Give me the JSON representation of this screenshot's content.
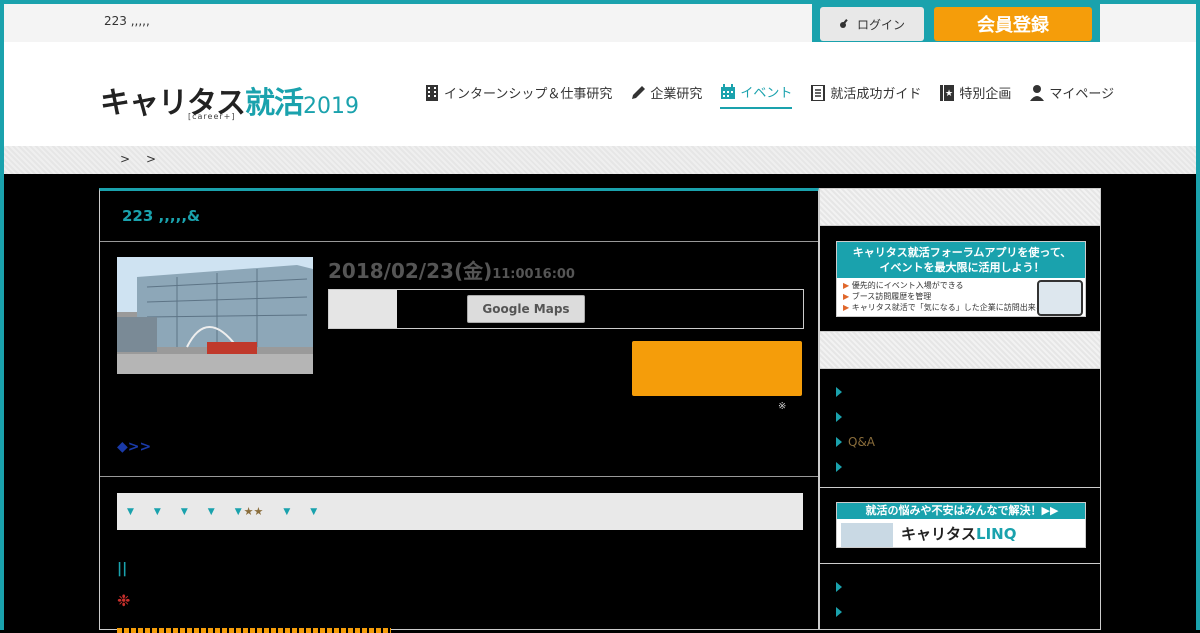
{
  "top": {
    "crumb": "223 ,,,,,",
    "login_label": "ログイン",
    "register_label": "会員登録"
  },
  "logo": {
    "main": "キャリタス",
    "accent": "就活",
    "year": "2019",
    "sub": "[career+]"
  },
  "nav": [
    {
      "label": "インターンシップ＆仕事研究",
      "icon": "building-icon"
    },
    {
      "label": "企業研究",
      "icon": "pencil-icon"
    },
    {
      "label": "イベント",
      "icon": "calendar-icon",
      "active": true
    },
    {
      "label": "就活成功ガイド",
      "icon": "document-icon"
    },
    {
      "label": "特別企画",
      "icon": "star-book-icon"
    },
    {
      "label": "マイページ",
      "icon": "user-icon"
    }
  ],
  "breadcrumb": {
    "sep1": ">",
    "sep2": ">"
  },
  "event": {
    "title": "223 ,,,,,&",
    "date": "2018/02/23(金)",
    "time": "11:0016:00",
    "map_button": "Google Maps",
    "note": "※",
    "more_link": "◆>>",
    "tags": [
      "▼",
      "▼",
      "▼",
      "▼",
      "▼",
      "▼",
      "▼"
    ],
    "stars": "★★",
    "mark1": "||",
    "mark2": "❉"
  },
  "sidebar": {
    "banner1": {
      "title_line1": "キャリタス就活フォーラムアプリを使って、",
      "title_line2": "イベントを最大限に活用しよう！",
      "bullets": [
        "優先的にイベント入場ができる",
        "ブース訪問履歴を管理",
        "キャリタス就活で「気になる」した企業に訪問出来る"
      ]
    },
    "links1": [
      "",
      "",
      "Q&A",
      ""
    ],
    "banner2": {
      "title": "就活の悩みや不安はみんなで解決！▶▶",
      "brand": "キャリタス",
      "brand_accent": "LINQ"
    },
    "links2": [
      "",
      ""
    ]
  }
}
